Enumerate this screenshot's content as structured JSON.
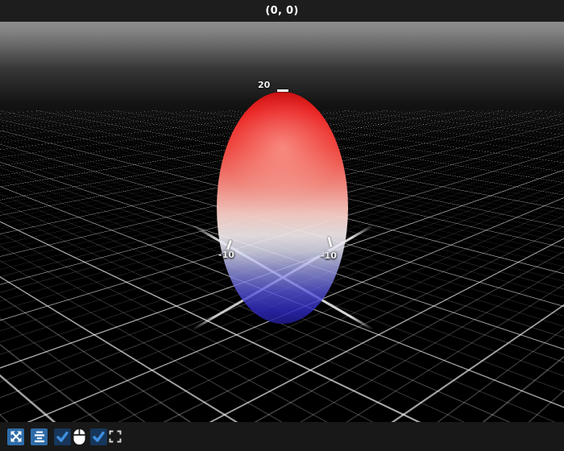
{
  "window": {
    "title": "(0, 0)"
  },
  "scene": {
    "axis": {
      "z_max_label": "20",
      "x_min_label": "-10",
      "y_min_label": "-10"
    },
    "colors": {
      "background": "#000000",
      "grid_minor": "#565656",
      "grid_major": "#9b9b9b",
      "glyph_top": "#e91919",
      "glyph_middle": "#f7f0f2",
      "glyph_bottom": "#1e198c"
    }
  },
  "toolbar": {
    "background": "#181818",
    "button_color": "#2e6ca8",
    "checkbox_color": "#17365a",
    "check_color": "#3f8fe0",
    "items": [
      {
        "name": "expand-arrows-button",
        "icon": "arrows-expand-icon",
        "type": "button"
      },
      {
        "name": "align-center-button",
        "icon": "align-center-icon",
        "type": "button"
      },
      {
        "name": "mouse-controls-checkbox",
        "icon": "checkmark-icon",
        "type": "checkbox",
        "checked": true
      },
      {
        "name": "mouse-indicator",
        "icon": "mouse-icon",
        "type": "indicator"
      },
      {
        "name": "fullscreen-checkbox",
        "icon": "checkmark-icon",
        "type": "checkbox",
        "checked": true
      },
      {
        "name": "fullscreen-button",
        "icon": "fullscreen-icon",
        "type": "button"
      }
    ]
  }
}
